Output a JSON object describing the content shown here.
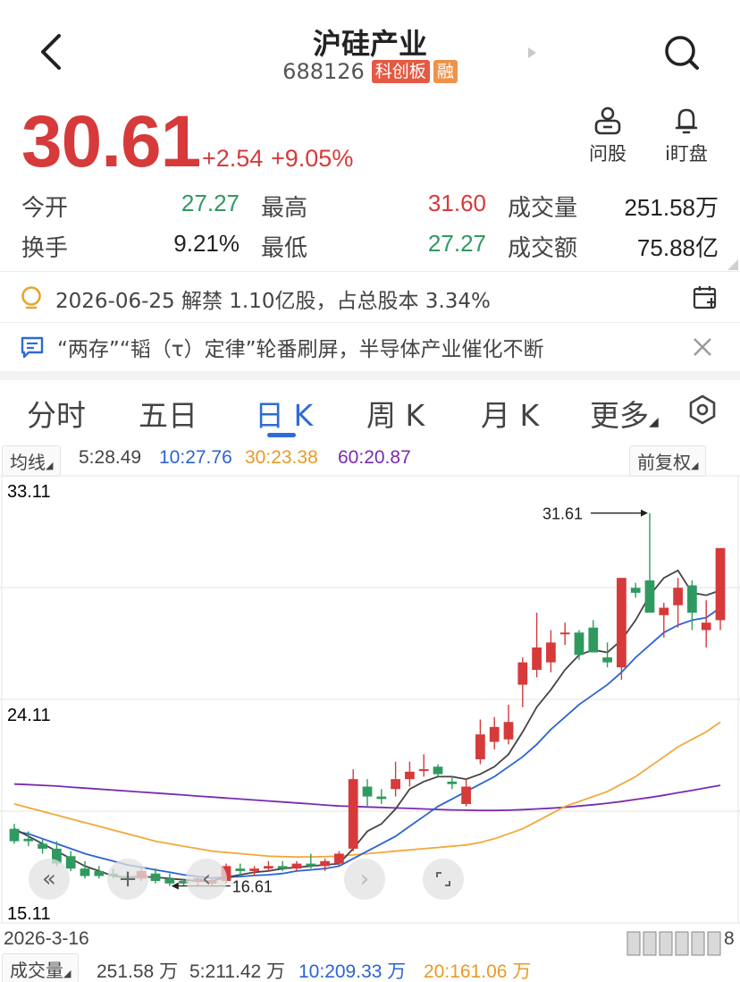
{
  "header": {
    "title": "沪硅产业",
    "code": "688126",
    "tags": [
      "科创板",
      "融"
    ],
    "icons": {
      "back": "back-arrow-icon",
      "search": "search-icon"
    }
  },
  "quote": {
    "price": "30.61",
    "change": "+2.54",
    "change_pct": "+9.05%",
    "actions": [
      {
        "label": "问股",
        "icon": "robot-icon"
      },
      {
        "label": "i盯盘",
        "icon": "bell-icon"
      }
    ]
  },
  "stats": {
    "open_label": "今开",
    "open": "27.27",
    "high_label": "最高",
    "high": "31.60",
    "volume_label": "成交量",
    "volume": "251.58万",
    "turnover_label": "换手",
    "turnover": "9.21%",
    "low_label": "最低",
    "low": "27.27",
    "amount_label": "成交额",
    "amount": "75.88亿"
  },
  "notices": {
    "unlock": "2026-06-25 解禁 1.10亿股，占总股本 3.34%",
    "news": "“两存”“韬（τ）定律”轮番刷屏，半导体产业催化不断"
  },
  "tabs": [
    {
      "label": "分时",
      "active": false
    },
    {
      "label": "五日",
      "active": false
    },
    {
      "label": "日 K",
      "active": true
    },
    {
      "label": "周 K",
      "active": false
    },
    {
      "label": "月 K",
      "active": false
    },
    {
      "label": "更多",
      "active": false
    }
  ],
  "ma": {
    "selector": "均线",
    "ma5": "5:28.49",
    "ma10": "10:27.76",
    "ma30": "30:23.38",
    "ma60": "60:20.87",
    "adjust": "前复权",
    "colors": {
      "ma5": "#444444",
      "ma10": "#2c63d4",
      "ma30": "#f0a93a",
      "ma60": "#7a2bb0",
      "up": "#d63a3a",
      "down": "#2f9a5f"
    }
  },
  "chart_data": {
    "type": "candlestick",
    "y_ticks": [
      "33.11",
      "24.11",
      "15.11"
    ],
    "ylim": [
      15.11,
      33.11
    ],
    "max_annotation": "31.61",
    "min_annotation": "16.61",
    "start_date": "2026-3-16",
    "end_date_fragment": "8",
    "candles": [
      {
        "o": 18.9,
        "h": 19.1,
        "l": 18.3,
        "c": 18.4
      },
      {
        "o": 18.5,
        "h": 18.8,
        "l": 18.2,
        "c": 18.4
      },
      {
        "o": 18.3,
        "h": 18.5,
        "l": 17.9,
        "c": 18.1
      },
      {
        "o": 18.1,
        "h": 18.4,
        "l": 17.4,
        "c": 17.5
      },
      {
        "o": 17.8,
        "h": 18.0,
        "l": 17.2,
        "c": 17.3
      },
      {
        "o": 17.3,
        "h": 17.6,
        "l": 16.9,
        "c": 17.0
      },
      {
        "o": 17.2,
        "h": 17.4,
        "l": 16.9,
        "c": 17.0
      },
      {
        "o": 17.1,
        "h": 17.3,
        "l": 16.9,
        "c": 17.0
      },
      {
        "o": 17.0,
        "h": 17.2,
        "l": 16.8,
        "c": 16.95
      },
      {
        "o": 16.9,
        "h": 17.3,
        "l": 16.8,
        "c": 17.2
      },
      {
        "o": 17.1,
        "h": 17.3,
        "l": 16.7,
        "c": 16.8
      },
      {
        "o": 16.9,
        "h": 17.1,
        "l": 16.6,
        "c": 16.7
      },
      {
        "o": 16.8,
        "h": 16.9,
        "l": 16.61,
        "c": 16.7
      },
      {
        "o": 16.8,
        "h": 17.0,
        "l": 16.6,
        "c": 16.9
      },
      {
        "o": 16.7,
        "h": 16.9,
        "l": 16.6,
        "c": 16.8
      },
      {
        "o": 16.8,
        "h": 17.5,
        "l": 16.7,
        "c": 17.4
      },
      {
        "o": 17.3,
        "h": 17.5,
        "l": 17.0,
        "c": 17.2
      },
      {
        "o": 17.2,
        "h": 17.4,
        "l": 17.0,
        "c": 17.3
      },
      {
        "o": 17.3,
        "h": 17.6,
        "l": 17.2,
        "c": 17.4
      },
      {
        "o": 17.4,
        "h": 17.6,
        "l": 17.2,
        "c": 17.3
      },
      {
        "o": 17.3,
        "h": 17.6,
        "l": 17.2,
        "c": 17.5
      },
      {
        "o": 17.5,
        "h": 17.9,
        "l": 17.3,
        "c": 17.4
      },
      {
        "o": 17.4,
        "h": 17.7,
        "l": 17.2,
        "c": 17.6
      },
      {
        "o": 17.5,
        "h": 18.0,
        "l": 17.4,
        "c": 17.9
      },
      {
        "o": 18.1,
        "h": 21.3,
        "l": 18.0,
        "c": 20.9
      },
      {
        "o": 20.6,
        "h": 20.9,
        "l": 19.8,
        "c": 20.2
      },
      {
        "o": 20.2,
        "h": 20.5,
        "l": 19.9,
        "c": 20.1
      },
      {
        "o": 20.5,
        "h": 21.6,
        "l": 20.2,
        "c": 20.9
      },
      {
        "o": 20.9,
        "h": 21.6,
        "l": 20.6,
        "c": 21.2
      },
      {
        "o": 21.3,
        "h": 21.9,
        "l": 21.0,
        "c": 21.3
      },
      {
        "o": 21.4,
        "h": 21.5,
        "l": 21.0,
        "c": 21.1
      },
      {
        "o": 20.8,
        "h": 21.0,
        "l": 20.5,
        "c": 20.7
      },
      {
        "o": 19.9,
        "h": 20.9,
        "l": 19.8,
        "c": 20.6
      },
      {
        "o": 21.7,
        "h": 23.3,
        "l": 21.5,
        "c": 22.7
      },
      {
        "o": 22.4,
        "h": 23.4,
        "l": 22.1,
        "c": 23.0
      },
      {
        "o": 22.5,
        "h": 23.9,
        "l": 22.3,
        "c": 23.2
      },
      {
        "o": 24.7,
        "h": 25.8,
        "l": 23.8,
        "c": 25.6
      },
      {
        "o": 25.3,
        "h": 27.6,
        "l": 25.0,
        "c": 26.2
      },
      {
        "o": 25.6,
        "h": 26.9,
        "l": 25.2,
        "c": 26.4
      },
      {
        "o": 26.8,
        "h": 27.2,
        "l": 26.3,
        "c": 26.8
      },
      {
        "o": 26.8,
        "h": 26.9,
        "l": 25.7,
        "c": 25.9
      },
      {
        "o": 27.0,
        "h": 27.3,
        "l": 26.0,
        "c": 26.0
      },
      {
        "o": 25.8,
        "h": 26.4,
        "l": 25.4,
        "c": 25.6
      },
      {
        "o": 25.4,
        "h": 29.0,
        "l": 24.9,
        "c": 29.0
      },
      {
        "o": 28.6,
        "h": 28.8,
        "l": 28.2,
        "c": 28.4
      },
      {
        "o": 28.9,
        "h": 31.61,
        "l": 27.7,
        "c": 27.6
      },
      {
        "o": 27.5,
        "h": 28.0,
        "l": 26.6,
        "c": 27.8
      },
      {
        "o": 27.9,
        "h": 29.0,
        "l": 27.0,
        "c": 28.6
      },
      {
        "o": 28.7,
        "h": 28.9,
        "l": 26.9,
        "c": 27.6
      },
      {
        "o": 26.9,
        "h": 28.1,
        "l": 26.2,
        "c": 27.2
      },
      {
        "o": 27.3,
        "h": 30.2,
        "l": 26.9,
        "c": 30.2
      }
    ],
    "ma5": [
      18.9,
      18.6,
      18.3,
      18.0,
      17.7,
      17.4,
      17.2,
      17.0,
      16.95,
      16.98,
      16.95,
      16.9,
      16.85,
      16.8,
      16.8,
      16.95,
      17.05,
      17.15,
      17.2,
      17.3,
      17.35,
      17.4,
      17.45,
      17.5,
      18.1,
      18.8,
      19.1,
      19.7,
      20.5,
      20.8,
      21.0,
      21.0,
      20.9,
      21.1,
      21.4,
      21.9,
      22.8,
      23.8,
      24.5,
      25.3,
      25.9,
      26.1,
      26.0,
      26.5,
      27.3,
      28.3,
      29.0,
      29.3,
      28.4,
      28.3,
      28.5
    ],
    "ma10": [
      18.8,
      18.7,
      18.5,
      18.3,
      18.1,
      17.9,
      17.75,
      17.6,
      17.45,
      17.35,
      17.25,
      17.15,
      17.05,
      16.98,
      16.92,
      16.95,
      16.98,
      17.02,
      17.05,
      17.1,
      17.2,
      17.25,
      17.3,
      17.4,
      17.7,
      18.0,
      18.3,
      18.6,
      19.0,
      19.4,
      19.8,
      20.1,
      20.4,
      20.7,
      21.0,
      21.4,
      21.8,
      22.3,
      22.9,
      23.4,
      23.9,
      24.3,
      24.7,
      25.2,
      25.8,
      26.3,
      26.8,
      27.1,
      27.3,
      27.4,
      27.8
    ],
    "ma30": [
      19.9,
      19.75,
      19.6,
      19.45,
      19.3,
      19.15,
      19.0,
      18.85,
      18.7,
      18.55,
      18.4,
      18.3,
      18.2,
      18.1,
      18.0,
      17.95,
      17.9,
      17.85,
      17.8,
      17.78,
      17.77,
      17.77,
      17.78,
      17.8,
      17.85,
      17.9,
      17.95,
      18.0,
      18.05,
      18.1,
      18.15,
      18.2,
      18.25,
      18.35,
      18.5,
      18.7,
      18.9,
      19.2,
      19.5,
      19.8,
      20.0,
      20.2,
      20.4,
      20.7,
      21.0,
      21.4,
      21.8,
      22.2,
      22.5,
      22.8,
      23.2
    ],
    "ma60": [
      20.7,
      20.68,
      20.65,
      20.62,
      20.58,
      20.54,
      20.5,
      20.46,
      20.42,
      20.38,
      20.34,
      20.3,
      20.26,
      20.22,
      20.18,
      20.14,
      20.1,
      20.06,
      20.02,
      19.98,
      19.94,
      19.9,
      19.86,
      19.82,
      19.8,
      19.78,
      19.76,
      19.74,
      19.72,
      19.7,
      19.68,
      19.66,
      19.65,
      19.64,
      19.64,
      19.65,
      19.67,
      19.7,
      19.73,
      19.77,
      19.82,
      19.87,
      19.93,
      20.0,
      20.08,
      20.16,
      20.25,
      20.35,
      20.45,
      20.55,
      20.65
    ]
  },
  "controls": {
    "zoom_out_icon": "double-chevron-left-icon",
    "plus_icon": "plus-icon",
    "prev_icon": "chevron-left-icon",
    "next_icon": "chevron-right-icon",
    "fit_icon": "fit-corner-icon"
  },
  "volume": {
    "selector": "成交量",
    "vol": "251.58 万",
    "v5": "5:211.42 万",
    "v10": "10:209.33 万",
    "v20": "20:161.06 万"
  }
}
